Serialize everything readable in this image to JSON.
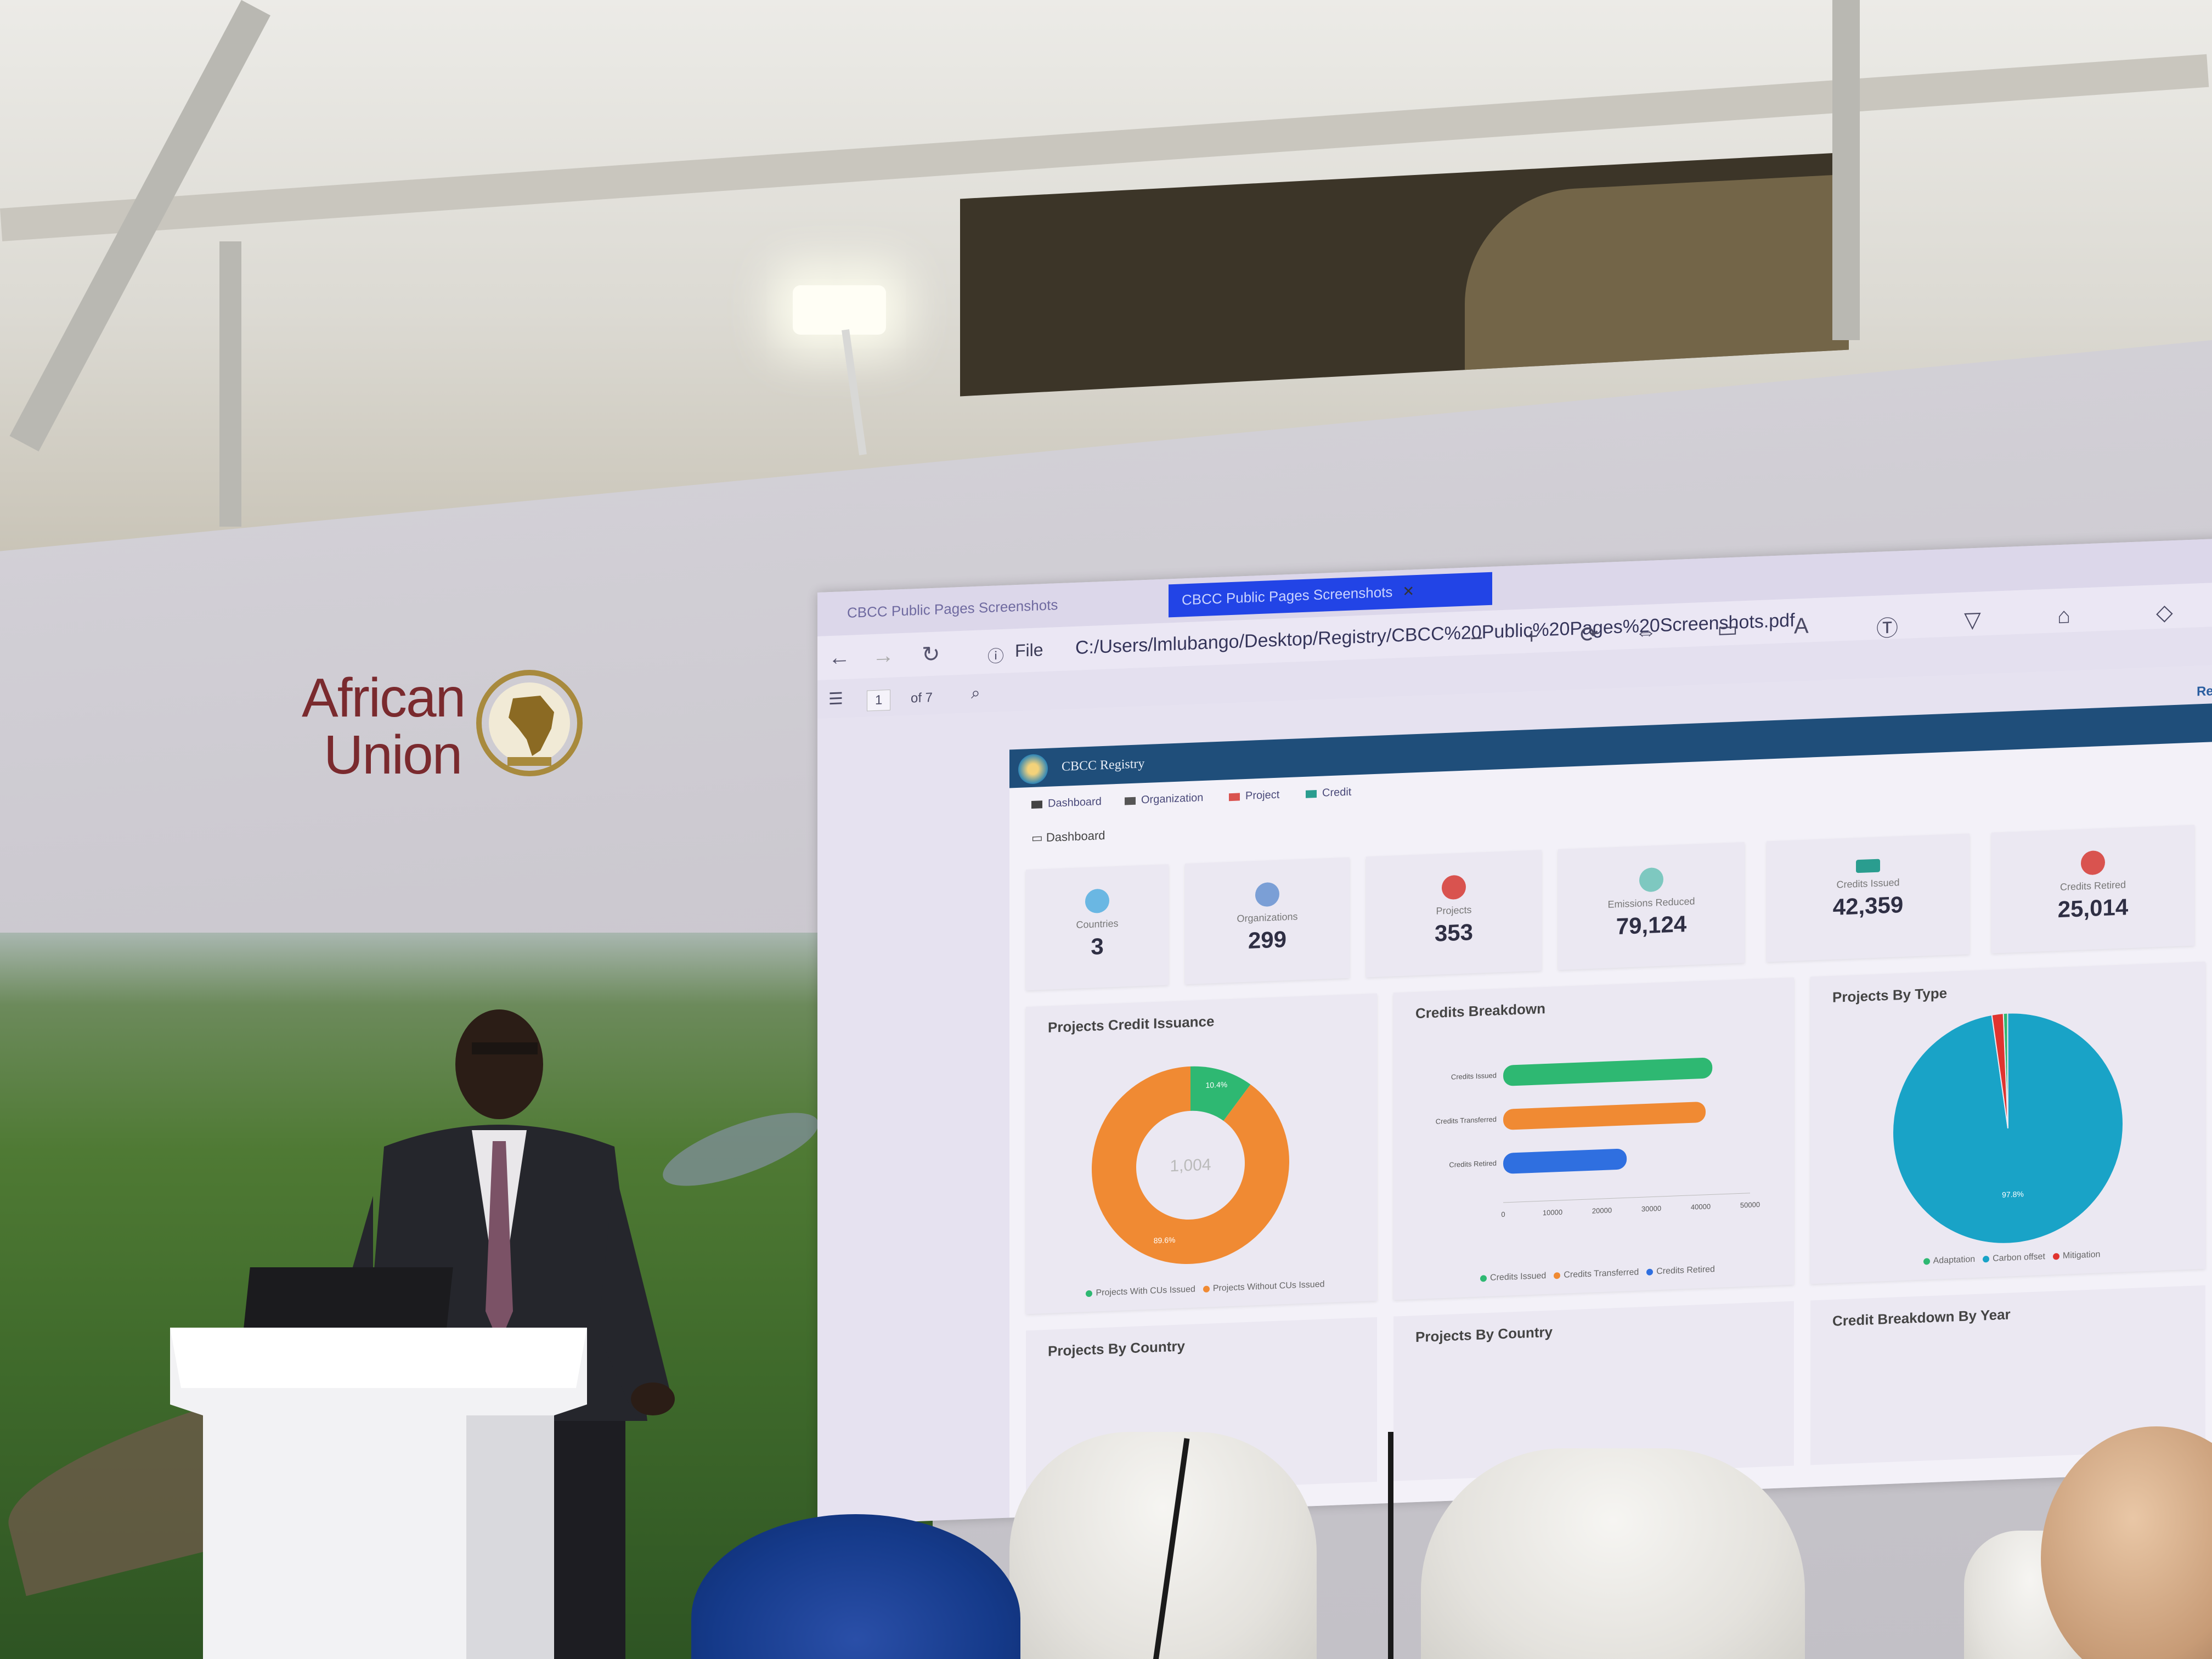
{
  "banner": {
    "logo_line1": "African",
    "logo_line2": "Union"
  },
  "browser": {
    "tab1_title": "CBCC Public Pages Screenshots",
    "tab2_title": "CBCC Public Pages Screenshots",
    "file_label": "File",
    "url": "C:/Users/lmlubango/Desktop/Registry/CBCC%20Public%20Pages%20Screenshots.pdf",
    "page_current": "1",
    "page_total": "of 7"
  },
  "app": {
    "title": "CBCC Registry",
    "register_link": "Register",
    "nav": [
      "Dashboard",
      "Organization",
      "Project",
      "Credit"
    ],
    "breadcrumb": "Dashboard",
    "stats": [
      {
        "label": "Countries",
        "value": "3",
        "color": "#6ab7e3"
      },
      {
        "label": "Organizations",
        "value": "299",
        "color": "#7b9fd6"
      },
      {
        "label": "Projects",
        "value": "353",
        "color": "#d9534f"
      },
      {
        "label": "Emissions Reduced",
        "value": "79,124",
        "color": "#7ec8c0"
      },
      {
        "label": "Credits Issued",
        "value": "42,359",
        "color": "#2a9d8f"
      },
      {
        "label": "Credits Retired",
        "value": "25,014",
        "color": "#d9534f"
      }
    ],
    "panels": {
      "issuance_title": "Projects Credit Issuance",
      "breakdown_title": "Credits Breakdown",
      "bytype_title": "Projects By Type",
      "bottom1_title": "Projects By Country",
      "bottom2_title": "Projects By Country",
      "bottom3_title": "Credit Breakdown By Year"
    }
  },
  "chart_data": [
    {
      "type": "pie",
      "title": "Projects Credit Issuance",
      "center_label": "1,004",
      "categories": [
        "Projects With CUs Issued",
        "Projects Without CUs Issued"
      ],
      "values": [
        10.4,
        89.6
      ],
      "slice_labels": [
        "10.4%",
        "89.6%"
      ],
      "colors": [
        "#2eb872",
        "#f08a33"
      ]
    },
    {
      "type": "bar",
      "title": "Credits Breakdown",
      "orientation": "horizontal",
      "categories": [
        "Credits Issued",
        "Credits Transferred",
        "Credits Retired"
      ],
      "values": [
        42359,
        41000,
        25014
      ],
      "colors": [
        "#2eb872",
        "#f08a33",
        "#2f6fe0"
      ],
      "xlim": [
        0,
        50000
      ],
      "xticks": [
        "0",
        "10000",
        "20000",
        "30000",
        "40000",
        "50000"
      ],
      "legend": [
        "Credits Issued",
        "Credits Transferred",
        "Credits Retired"
      ]
    },
    {
      "type": "pie",
      "title": "Projects By Type",
      "categories": [
        "Adaptation",
        "Carbon offset",
        "Mitigation"
      ],
      "values": [
        0.6,
        97.8,
        1.6
      ],
      "slice_labels": [
        "",
        "97.8%",
        ""
      ],
      "colors": [
        "#2eb872",
        "#19a3c7",
        "#e0342f"
      ]
    }
  ]
}
